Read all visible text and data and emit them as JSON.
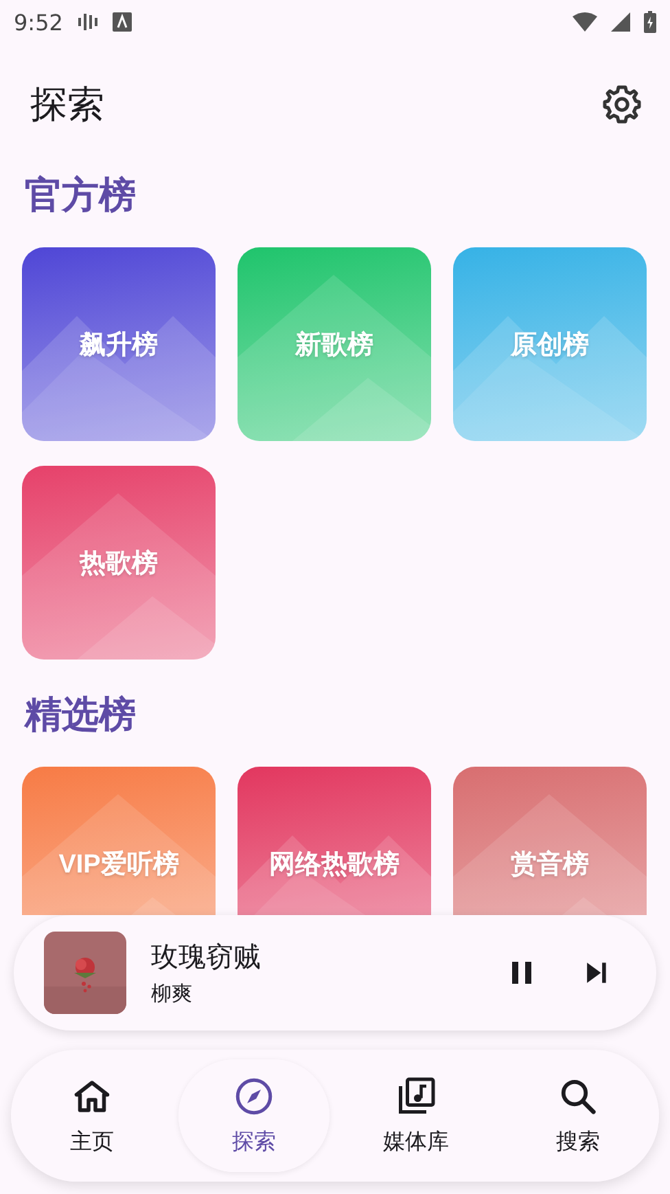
{
  "status_bar": {
    "time": "9:52"
  },
  "header": {
    "title": "探索"
  },
  "sections": [
    {
      "title": "官方榜",
      "tiles": [
        {
          "label": "飙升榜",
          "color": "#4f46d6"
        },
        {
          "label": "新歌榜",
          "color": "#1fc46c"
        },
        {
          "label": "原创榜",
          "color": "#36b2e6"
        },
        {
          "label": "热歌榜",
          "color": "#e6416a"
        }
      ]
    },
    {
      "title": "精选榜",
      "tiles": [
        {
          "label": "VIP爱听榜",
          "color": "#f77b45"
        },
        {
          "label": "网络热歌榜",
          "color": "#e2375f"
        },
        {
          "label": "赏音榜",
          "color": "#d86e70"
        }
      ]
    }
  ],
  "now_playing": {
    "title": "玫瑰窃贼",
    "artist": "柳爽",
    "playing": true
  },
  "nav": [
    {
      "label": "主页",
      "selected": false
    },
    {
      "label": "探索",
      "selected": true
    },
    {
      "label": "媒体库",
      "selected": false
    },
    {
      "label": "搜索",
      "selected": false
    }
  ]
}
